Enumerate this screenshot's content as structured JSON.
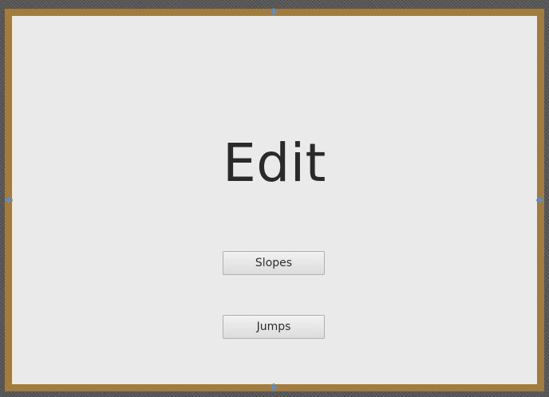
{
  "screen": {
    "title": "Edit",
    "buttons": [
      {
        "label": "Slopes"
      },
      {
        "label": "Jumps"
      }
    ]
  },
  "colors": {
    "frame": "#a27b3f",
    "canvas": "#eaeaea",
    "handles": "#4f8fe6",
    "backdrop": "#5a5a5a"
  }
}
